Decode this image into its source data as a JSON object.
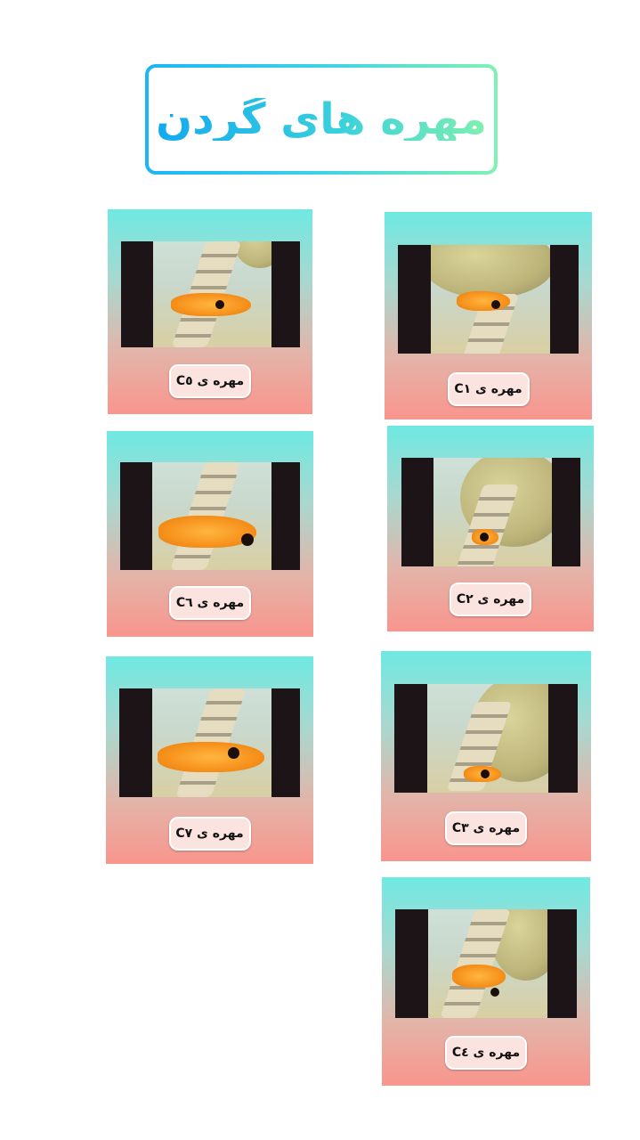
{
  "title": "مهره های گردن",
  "cards": [
    {
      "id": "c1",
      "label": "مهره ی C۱"
    },
    {
      "id": "c2",
      "label": "مهره ی C۲"
    },
    {
      "id": "c3",
      "label": "مهره ی C۳"
    },
    {
      "id": "c4",
      "label": "مهره ی C٤"
    },
    {
      "id": "c5",
      "label": "مهره ی C٥"
    },
    {
      "id": "c6",
      "label": "مهره ی C٦"
    },
    {
      "id": "c7",
      "label": "مهره ی C٧"
    }
  ]
}
